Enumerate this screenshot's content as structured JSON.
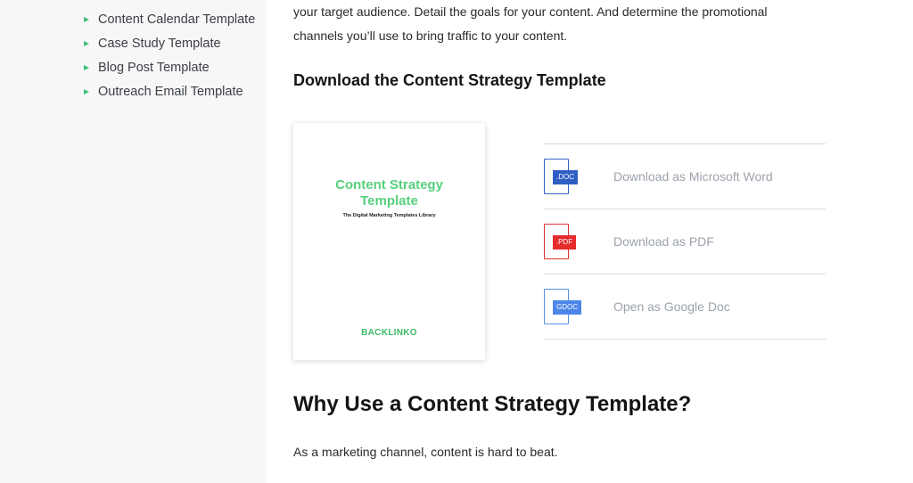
{
  "sidebar": {
    "items": [
      {
        "label": "Content Calendar Template"
      },
      {
        "label": "Case Study Template"
      },
      {
        "label": "Blog Post Template"
      },
      {
        "label": "Outreach Email Template"
      }
    ]
  },
  "main": {
    "intro_lines": [
      "your target audience. Detail the goals for your content. And determine the promotional",
      "channels you’ll use to bring traffic to your content."
    ],
    "download_heading": "Download the Content Strategy Template",
    "card": {
      "title_line1": "Content Strategy",
      "title_line2": "Template",
      "subtitle": "The Digital Marketing Templates Library",
      "logo": "BACKLINKO"
    },
    "downloads": [
      {
        "badge": ".DOC",
        "label": "Download as Microsoft Word",
        "icon": "doc-file-icon",
        "color": "#2f5fc4"
      },
      {
        "badge": ".PDF",
        "label": "Download as PDF",
        "icon": "pdf-file-icon",
        "color": "#e52b2b"
      },
      {
        "badge": "GDOC",
        "label": "Open as Google Doc",
        "icon": "google-doc-file-icon",
        "color": "#4d86e9"
      }
    ],
    "why_heading": "Why Use a Content Strategy Template?",
    "why_text": "As a marketing channel, content is hard to beat."
  },
  "colors": {
    "accent_green": "#57cf7e",
    "bullet_green": "#3fbf76",
    "sidebar_bg": "#f7f7f8",
    "muted_text": "#9ca3ad"
  }
}
